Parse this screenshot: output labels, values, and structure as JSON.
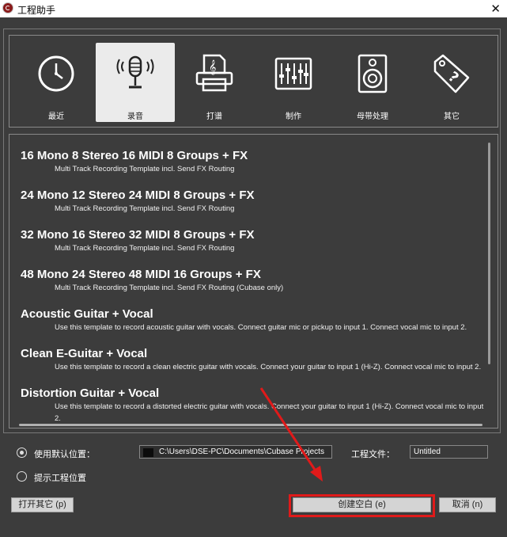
{
  "window": {
    "title": "工程助手",
    "close_glyph": "✕"
  },
  "categories": [
    {
      "label": "最近",
      "icon": "clock-icon",
      "selected": false
    },
    {
      "label": "录音",
      "icon": "microphone-icon",
      "selected": true
    },
    {
      "label": "打谱",
      "icon": "score-printer-icon",
      "selected": false
    },
    {
      "label": "制作",
      "icon": "mixer-faders-icon",
      "selected": false
    },
    {
      "label": "母带处理",
      "icon": "speaker-icon",
      "selected": false
    },
    {
      "label": "其它",
      "icon": "tag-question-icon",
      "selected": false
    }
  ],
  "templates": [
    {
      "name": "16 Mono 8 Stereo 16 MIDI 8 Groups + FX",
      "desc": "Multi Track Recording Template incl. Send FX Routing"
    },
    {
      "name": "24 Mono 12 Stereo 24 MIDI 8 Groups + FX",
      "desc": "Multi Track Recording Template incl. Send FX Routing"
    },
    {
      "name": "32 Mono 16 Stereo 32 MIDI 8 Groups + FX",
      "desc": "Multi Track Recording Template incl. Send FX Routing"
    },
    {
      "name": "48 Mono 24 Stereo 48 MIDI 16 Groups + FX",
      "desc": "Multi Track Recording Template incl. Send FX Routing (Cubase only)"
    },
    {
      "name": "Acoustic Guitar + Vocal",
      "desc": "Use this template to record acoustic guitar with vocals. Connect guitar mic or pickup to input  1. Connect vocal mic to input 2."
    },
    {
      "name": "Clean E-Guitar + Vocal",
      "desc": "Use this template to record a clean electric guitar with vocals. Connect your guitar to input  1 (Hi-Z). Connect vocal mic to input 2."
    },
    {
      "name": "Distortion Guitar + Vocal",
      "desc": "Use this template to record a distorted electric guitar with vocals. Connect your guitar to input  1 (Hi-Z). Connect vocal mic to input 2."
    }
  ],
  "location": {
    "default_label": "使用默认位置：",
    "default_selected": true,
    "path": "C:\\Users\\DSE-PC\\Documents\\Cubase Projects",
    "prompt_label": "提示工程位置",
    "file_label": "工程文件：",
    "file_name": "Untitled"
  },
  "buttons": {
    "open_other": "打开其它 (p)",
    "create_empty": "创建空白 (e)",
    "cancel": "取消 (n)"
  },
  "annotation": {
    "color": "#e01a1a"
  }
}
